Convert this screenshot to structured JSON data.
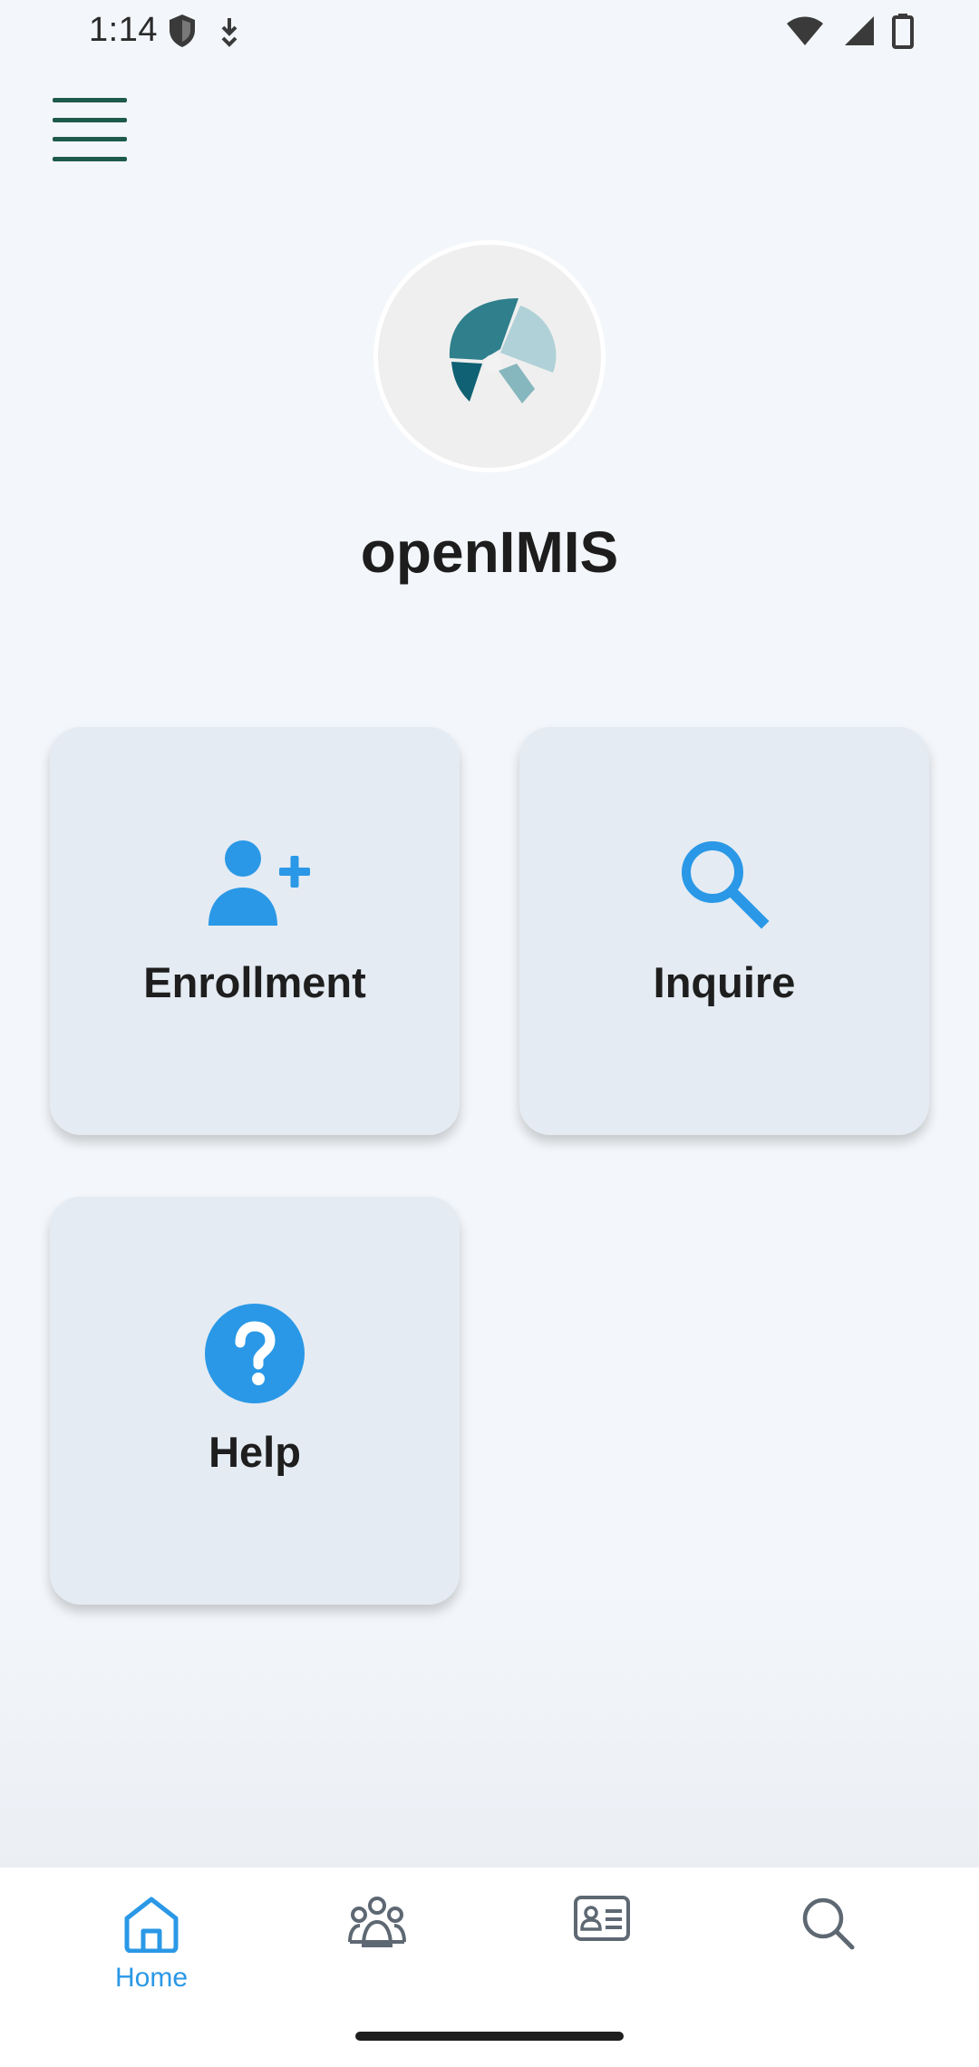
{
  "status_bar": {
    "time": "1:14",
    "icons": [
      "shield-icon",
      "download-icon",
      "wifi-icon",
      "signal-icon",
      "battery-icon"
    ]
  },
  "header": {
    "menu_icon": "hamburger-menu-icon"
  },
  "app": {
    "name": "openIMIS",
    "logo_icon": "openimis-logo"
  },
  "tiles": [
    {
      "label": "Enrollment",
      "icon": "add-person-icon"
    },
    {
      "label": "Inquire",
      "icon": "search-icon"
    },
    {
      "label": "Help",
      "icon": "help-icon"
    }
  ],
  "bottom_nav": {
    "items": [
      {
        "label": "Home",
        "icon": "home-icon",
        "active": true
      },
      {
        "label": "",
        "icon": "family-icon",
        "active": false
      },
      {
        "label": "",
        "icon": "id-card-icon",
        "active": false
      },
      {
        "label": "",
        "icon": "search-icon",
        "active": false
      }
    ]
  },
  "colors": {
    "accent": "#2a98e6",
    "card_bg": "#e4ebf3",
    "page_bg": "#f3f6fa",
    "menu_green": "#1d5a4c",
    "nav_inactive": "#5e6873",
    "logo_teal_dark": "#0f6173",
    "logo_teal_mid": "#2f7f8c",
    "logo_teal_light": "#afd1d7"
  }
}
